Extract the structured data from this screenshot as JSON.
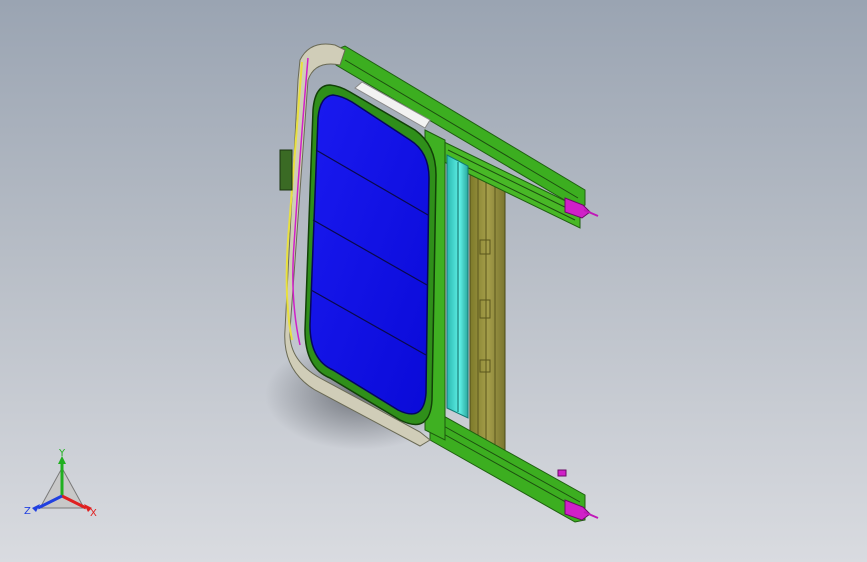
{
  "viewport": {
    "background_top": "#9aa4b2",
    "background_bottom": "#d9dbe0"
  },
  "model": {
    "glass_color": "#1010e8",
    "frame_color": "#3aa81e",
    "panel_color": "#8f8a3a",
    "deflector_color": "#3fd8d0",
    "clip_color": "#d020c8"
  },
  "triad": {
    "x_label": "X",
    "y_label": "Y",
    "z_label": "Z",
    "x_color": "#e02020",
    "y_color": "#20b020",
    "z_color": "#2040e0"
  }
}
